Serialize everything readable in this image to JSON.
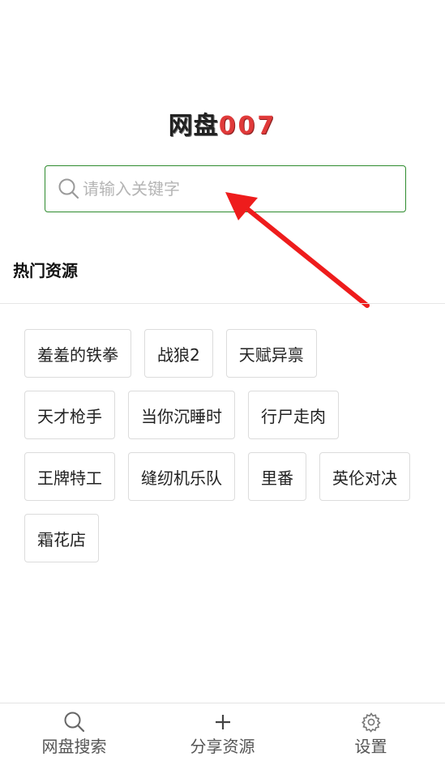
{
  "logo": {
    "part1": "网盘",
    "part2": "007"
  },
  "search": {
    "placeholder": "请输入关键字"
  },
  "hot": {
    "title": "热门资源",
    "rows": [
      [
        "羞羞的铁拳",
        "战狼2",
        "天赋异禀"
      ],
      [
        "天才枪手",
        "当你沉睡时",
        "行尸走肉"
      ],
      [
        "王牌特工",
        "缝纫机乐队",
        "里番",
        "英伦对决"
      ],
      [
        "霜花店"
      ]
    ]
  },
  "nav": {
    "items": [
      {
        "label": "网盘搜索",
        "icon": "search-icon"
      },
      {
        "label": "分享资源",
        "icon": "plus-icon"
      },
      {
        "label": "设置",
        "icon": "gear-icon"
      }
    ]
  },
  "colors": {
    "accent_green": "#2e8b2e",
    "logo_red": "#e03a3a",
    "annotation_red": "#ee1c1c"
  }
}
